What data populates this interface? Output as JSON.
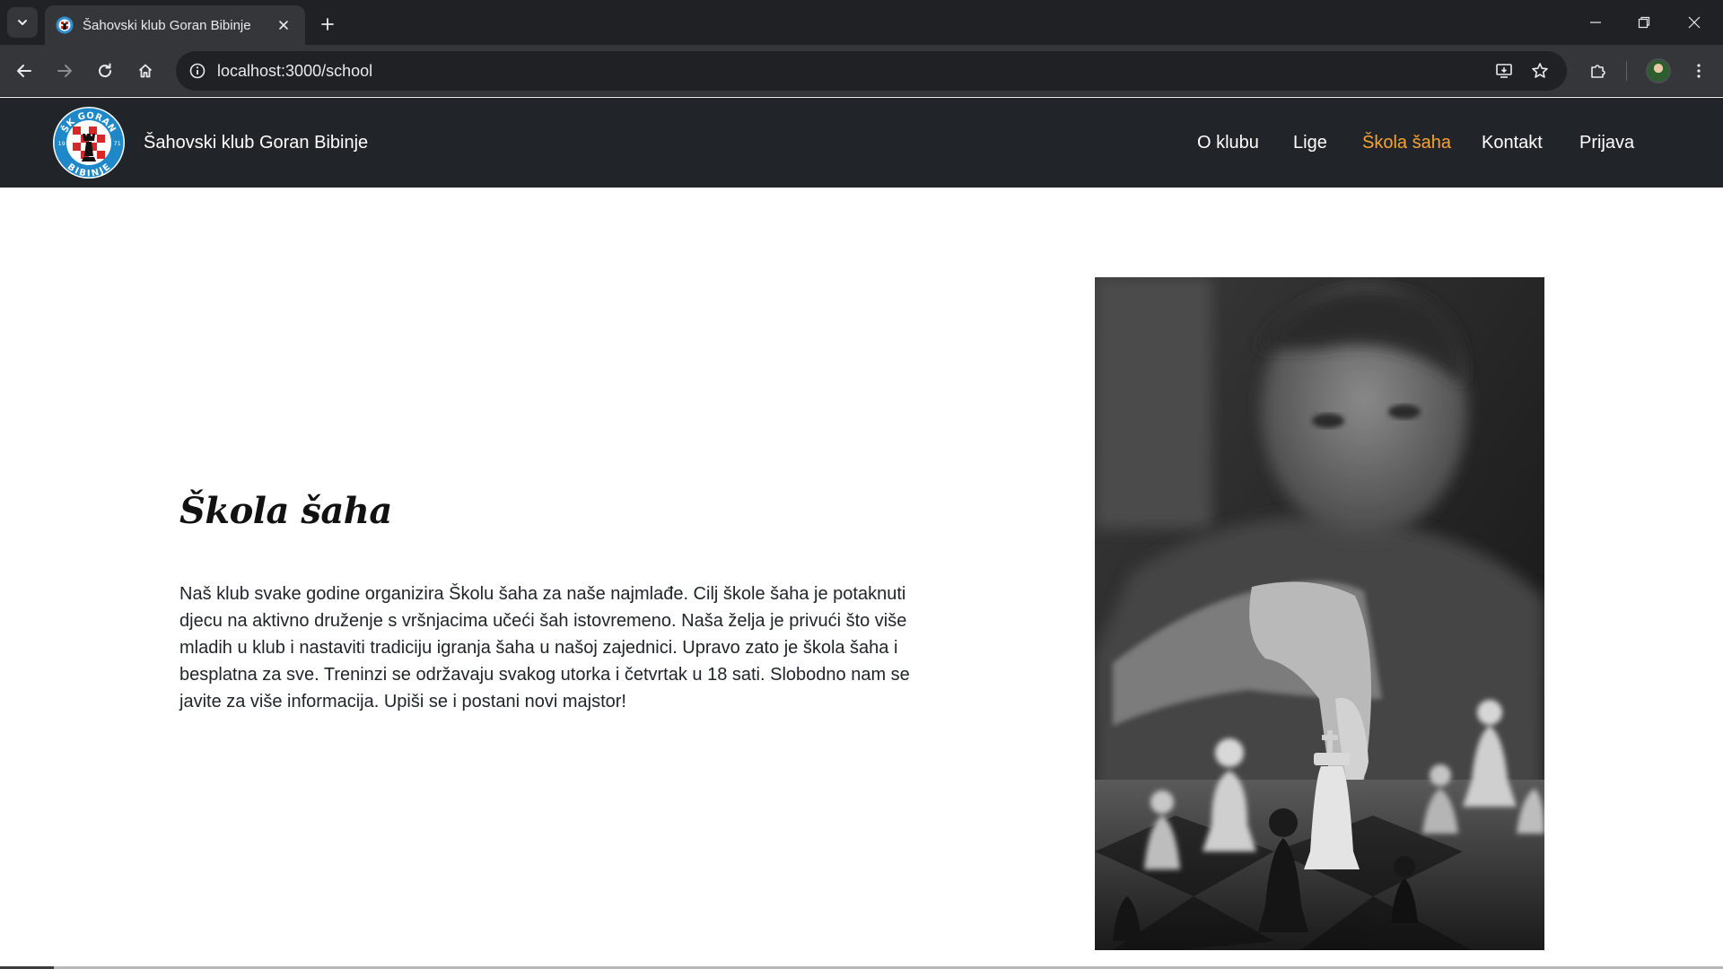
{
  "browser": {
    "tab_title": "Šahovski klub Goran Bibinje",
    "url": "localhost:3000/school",
    "icons": [
      "tab-search-icon",
      "close-icon",
      "plus-icon",
      "minimize-icon",
      "restore-icon",
      "close-window-icon",
      "back-icon",
      "forward-icon",
      "reload-icon",
      "home-icon",
      "info-icon",
      "install-icon",
      "star-icon",
      "extensions-icon",
      "menu-icon"
    ]
  },
  "site": {
    "brand": "Šahovski klub Goran Bibinje",
    "logo": {
      "top_text": "ŠK GORAN",
      "bottom_text": "BIBINJE",
      "left_number": "19",
      "right_number": "71"
    },
    "nav": [
      {
        "label": "O klubu",
        "active": false
      },
      {
        "label": "Lige",
        "active": false
      },
      {
        "label": "Škola šaha",
        "active": true
      },
      {
        "label": "Kontakt",
        "active": false
      },
      {
        "label": "Prijava",
        "active": false
      }
    ],
    "accent_color": "#f7a331",
    "header_color": "#212529"
  },
  "main": {
    "title": "Škola šaha",
    "paragraph": "Naš klub svake godine organizira Školu šaha za naše najmlađe. Cilj škole šaha je potaknuti djecu na aktivno druženje s vršnjacima učeći šah istovremeno. Naša želja je privući što više mladih u klub i nastaviti tradiciju igranja šaha u našoj zajednici. Upravo zato je škola šaha i besplatna za sve. Treninzi se održavaju svakog utorka i četvrtak u 18 sati. Slobodno nam se javite za više informacija. Upiši se i postani novi majstor!"
  }
}
